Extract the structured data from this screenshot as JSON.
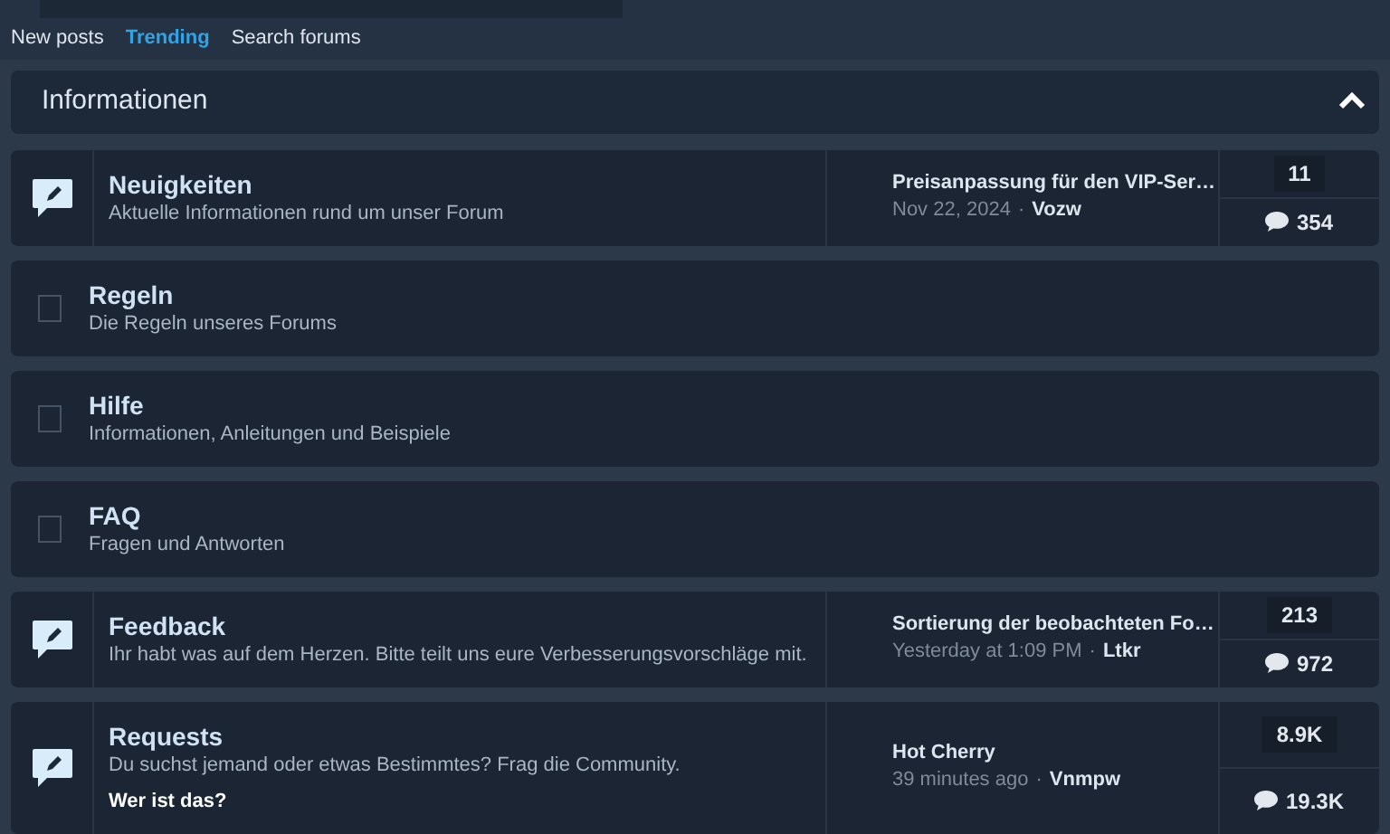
{
  "nav": [
    {
      "label": "New posts",
      "selected": false
    },
    {
      "label": "Trending",
      "selected": true
    },
    {
      "label": "Search forums",
      "selected": false
    }
  ],
  "category": {
    "title": "Informationen",
    "expanded": true
  },
  "forums": [
    {
      "kind": "full",
      "title": "Neuigkeiten",
      "description": "Aktuelle Informationen rund um unser Forum",
      "last_post": {
        "title": "Preisanpassung für den VIP-Ser…",
        "time": "Nov 22, 2024",
        "separator": "·",
        "user": "Vozw"
      },
      "threads": "11",
      "messages": "354"
    },
    {
      "kind": "simple",
      "title": "Regeln",
      "description": "Die Regeln unseres Forums"
    },
    {
      "kind": "simple",
      "title": "Hilfe",
      "description": "Informationen, Anleitungen und Beispiele"
    },
    {
      "kind": "simple",
      "title": "FAQ",
      "description": "Fragen und Antworten"
    },
    {
      "kind": "full",
      "title": "Feedback",
      "description": "Ihr habt was auf dem Herzen. Bitte teilt uns eure Verbesserungsvorschläge mit.",
      "last_post": {
        "title": "Sortierung der beobachteten Fo…",
        "time": "Yesterday at 1:09 PM",
        "separator": "·",
        "user": "Ltkr"
      },
      "threads": "213",
      "messages": "972"
    },
    {
      "kind": "full",
      "title": "Requests",
      "description": "Du suchst jemand oder etwas Bestimmtes? Frag die Community.",
      "subforum": "Wer ist das?",
      "last_post": {
        "title": "Hot Cherry",
        "time": "39 minutes ago",
        "separator": "·",
        "user": "Vnmpw"
      },
      "threads": "8.9K",
      "messages": "19.3K"
    }
  ]
}
